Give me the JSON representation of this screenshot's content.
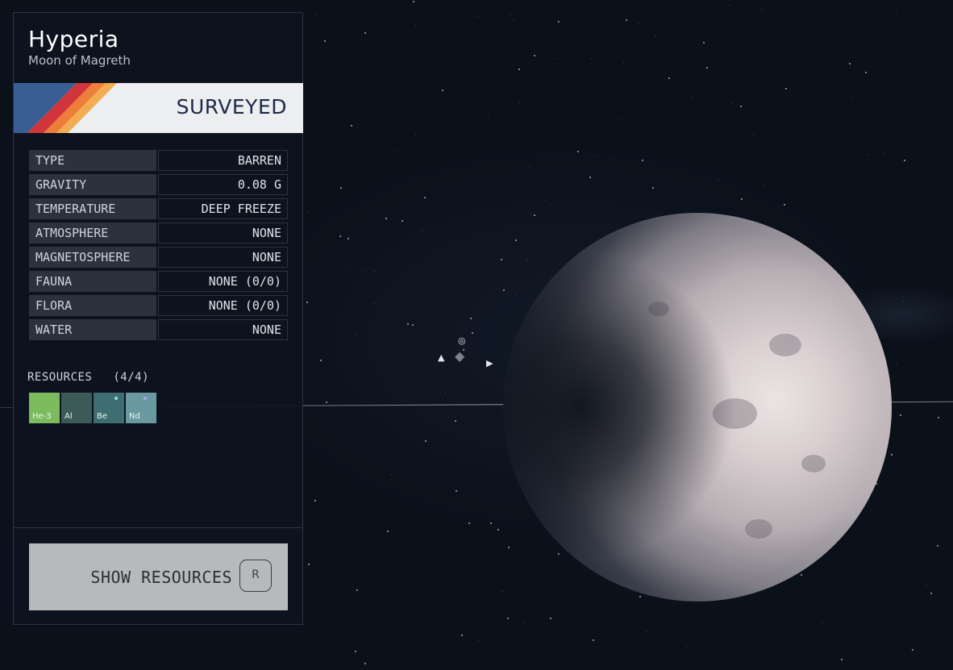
{
  "planet": {
    "name": "Hyperia",
    "subtitle": "Moon of Magreth",
    "status": "SURVEYED"
  },
  "colors": {
    "stripe_blue": "#3a5e93",
    "stripe_red": "#d2343c",
    "stripe_orange": "#ee7d3a",
    "stripe_yellow": "#f2ad52",
    "banner_bg": "#eceeef",
    "status_text": "#1c2a4a"
  },
  "stats": [
    {
      "label": "TYPE",
      "value": "BARREN"
    },
    {
      "label": "GRAVITY",
      "value": "0.08 G"
    },
    {
      "label": "TEMPERATURE",
      "value": "DEEP FREEZE"
    },
    {
      "label": "ATMOSPHERE",
      "value": "NONE"
    },
    {
      "label": "MAGNETOSPHERE",
      "value": "NONE"
    },
    {
      "label": "FAUNA",
      "value": "NONE (0/0)"
    },
    {
      "label": "FLORA",
      "value": "NONE (0/0)"
    },
    {
      "label": "WATER",
      "value": "NONE"
    }
  ],
  "resources": {
    "label": "RESOURCES",
    "count": "(4/4)",
    "items": [
      {
        "symbol": "He-3",
        "color": "#7dbb5f",
        "has_dot": false
      },
      {
        "symbol": "Al",
        "color": "#3c5a57",
        "has_dot": false
      },
      {
        "symbol": "Be",
        "color": "#3e6e72",
        "has_dot": true,
        "dot_color": "#8fe1e2"
      },
      {
        "symbol": "Nd",
        "color": "#6a9aa0",
        "has_dot": true,
        "dot_color": "#b59de8"
      }
    ]
  },
  "actions": {
    "show_resources": "SHOW RESOURCES",
    "show_resources_key": "R"
  }
}
